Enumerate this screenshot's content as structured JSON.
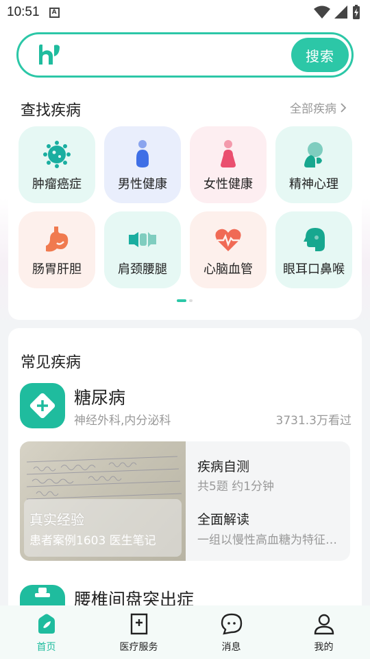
{
  "status_bar": {
    "time": "10:51"
  },
  "search": {
    "placeholder": "",
    "button_label": "搜索"
  },
  "find_section": {
    "title": "查找疾病",
    "see_all": "全部疾病",
    "categories": [
      {
        "label": "肿瘤癌症",
        "icon": "virus-icon"
      },
      {
        "label": "男性健康",
        "icon": "male-icon"
      },
      {
        "label": "女性健康",
        "icon": "female-icon"
      },
      {
        "label": "精神心理",
        "icon": "mind-icon"
      },
      {
        "label": "肠胃肝胆",
        "icon": "stomach-icon"
      },
      {
        "label": "肩颈腰腿",
        "icon": "bone-icon"
      },
      {
        "label": "心脑血管",
        "icon": "heart-icon"
      },
      {
        "label": "眼耳口鼻喉",
        "icon": "head-icon"
      }
    ]
  },
  "common_section": {
    "title": "常见疾病",
    "diseases": [
      {
        "name": "糖尿病",
        "departments": "神经外科,内分泌科",
        "views": "3731.3万看过",
        "experience": {
          "title": "真实经验",
          "subtitle": "患者案例1603 医生笔记"
        },
        "self_test": {
          "title": "疾病自测",
          "subtitle": "共5题 约1分钟"
        },
        "overview": {
          "title": "全面解读",
          "subtitle": "一组以慢性高血糖为特征的代谢性疾病"
        }
      },
      {
        "name": "腰椎间盘突出症"
      }
    ]
  },
  "bottom_nav": [
    {
      "label": "首页",
      "active": true
    },
    {
      "label": "医疗服务",
      "active": false
    },
    {
      "label": "消息",
      "active": false
    },
    {
      "label": "我的",
      "active": false
    }
  ],
  "colors": {
    "accent": "#2cc7a7",
    "accent_dark": "#1fbc9e"
  }
}
